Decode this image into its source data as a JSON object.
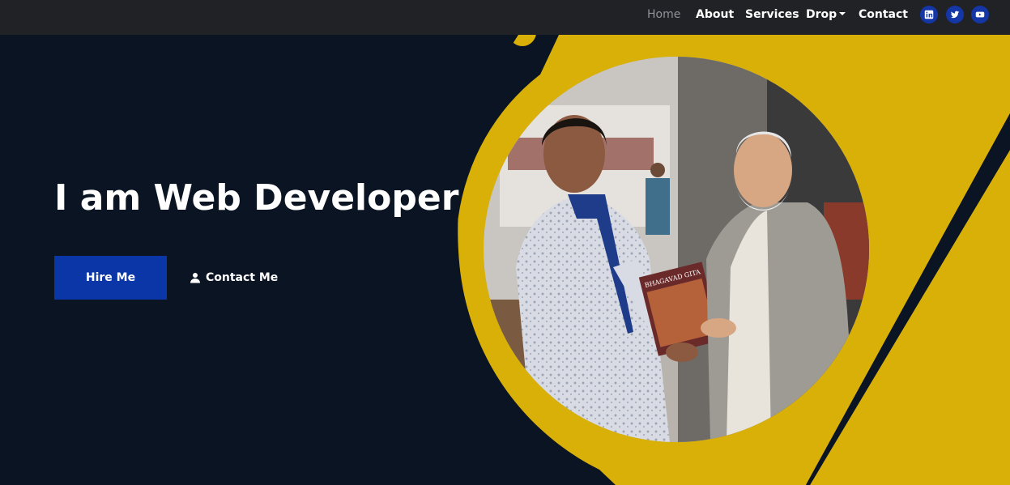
{
  "nav": {
    "items": [
      {
        "label": "Home",
        "active": true
      },
      {
        "label": "About",
        "active": false
      },
      {
        "label": "Services",
        "active": false
      },
      {
        "label": "Drop",
        "active": false,
        "dropdown": true
      },
      {
        "label": "Contact",
        "active": false
      }
    ],
    "social": [
      "linkedin-icon",
      "twitter-icon",
      "youtube-icon"
    ]
  },
  "hero": {
    "title": "I am Web Developer",
    "hire_label": "Hire Me",
    "contact_label": "Contact Me",
    "photo_book_text": "BHAGAVAD GITA"
  },
  "colors": {
    "background": "#0b1422",
    "navbar": "#212225",
    "accent_yellow": "#d9b007",
    "primary_blue": "#0a36a8",
    "nav_active": "#8e9299"
  }
}
